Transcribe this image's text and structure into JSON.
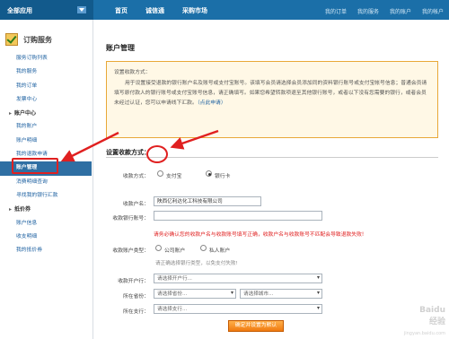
{
  "topbar": {
    "all_apps": "全部应用",
    "nav": [
      "首页",
      "诚信通",
      "采购市场"
    ],
    "user_links": [
      "我的订单",
      "我的服务",
      "我的账户",
      "我的帐户"
    ]
  },
  "sidebar": {
    "header": "订购服务",
    "items": [
      {
        "label": "服务订购列表",
        "type": "item"
      },
      {
        "label": "我的服务",
        "type": "item"
      },
      {
        "label": "我的订单",
        "type": "item"
      },
      {
        "label": "发票中心",
        "type": "item"
      },
      {
        "label": "账户中心",
        "type": "section"
      },
      {
        "label": "我的账户",
        "type": "item"
      },
      {
        "label": "账户明细",
        "type": "item"
      },
      {
        "label": "我的退款申请",
        "type": "item"
      },
      {
        "label": "账户管理",
        "type": "item",
        "active": true
      },
      {
        "label": "消费明细查询",
        "type": "item"
      },
      {
        "label": "寻找我的银行汇款",
        "type": "item"
      },
      {
        "label": "抵价券",
        "type": "section"
      },
      {
        "label": "账户信息",
        "type": "item"
      },
      {
        "label": "收支明细",
        "type": "item"
      },
      {
        "label": "我的抵价券",
        "type": "item"
      }
    ]
  },
  "main": {
    "title": "账户管理",
    "notice": {
      "title": "设置收款方式：",
      "body": "用于设置接受退款的银行账户名及账号或支付宝账号。该填写会员请选择会员添加同的资料银行账号或支付宝帐号信息；普通会员请填写原付款人的银行账号或支付宝账号信息，请正确填写。如果您希望转款项退至其他银行账号，或者以下没有您需要的银行，或者会员未经过认证，您可以申请线下汇款。",
      "link": "（点此申请）"
    },
    "section_title": "设置收款方式：",
    "form": {
      "method_label": "收款方式：",
      "method_options": [
        "支付宝",
        "银行卡"
      ],
      "method_selected": "银行卡",
      "account_name_label": "收款户名：",
      "account_name_value": "陕西亿利达化工科技有限公司",
      "account_no_label": "收款银行账号：",
      "account_no_value": "",
      "error_text": "请务必确认您的收款户名与收款账号填写正确，收款户名与收款账号不匹配会导致退款失败!",
      "account_type_label": "收款账户类型：",
      "account_type_options": [
        "公司账户",
        "私人账户"
      ],
      "account_type_hint": "请正确选择银行类型，以免支付失败!",
      "bank_label": "收款开户行：",
      "bank_placeholder": "请选择开户行...",
      "province_label": "所在省份：",
      "province_placeholder": "请选择省份...",
      "city_placeholder": "请选择城市...",
      "branch_label": "所在支行：",
      "branch_placeholder": "请选择支行...",
      "submit_label": "确定并设置为默认"
    }
  },
  "watermark": {
    "line1": "Baidu",
    "line2": "经验",
    "line3": "jingyan.baidu.com"
  },
  "colors": {
    "topbar": "#1b6fa8",
    "accent_red": "#e02020",
    "notice_border": "#e8a838",
    "submit": "#f07a10"
  }
}
